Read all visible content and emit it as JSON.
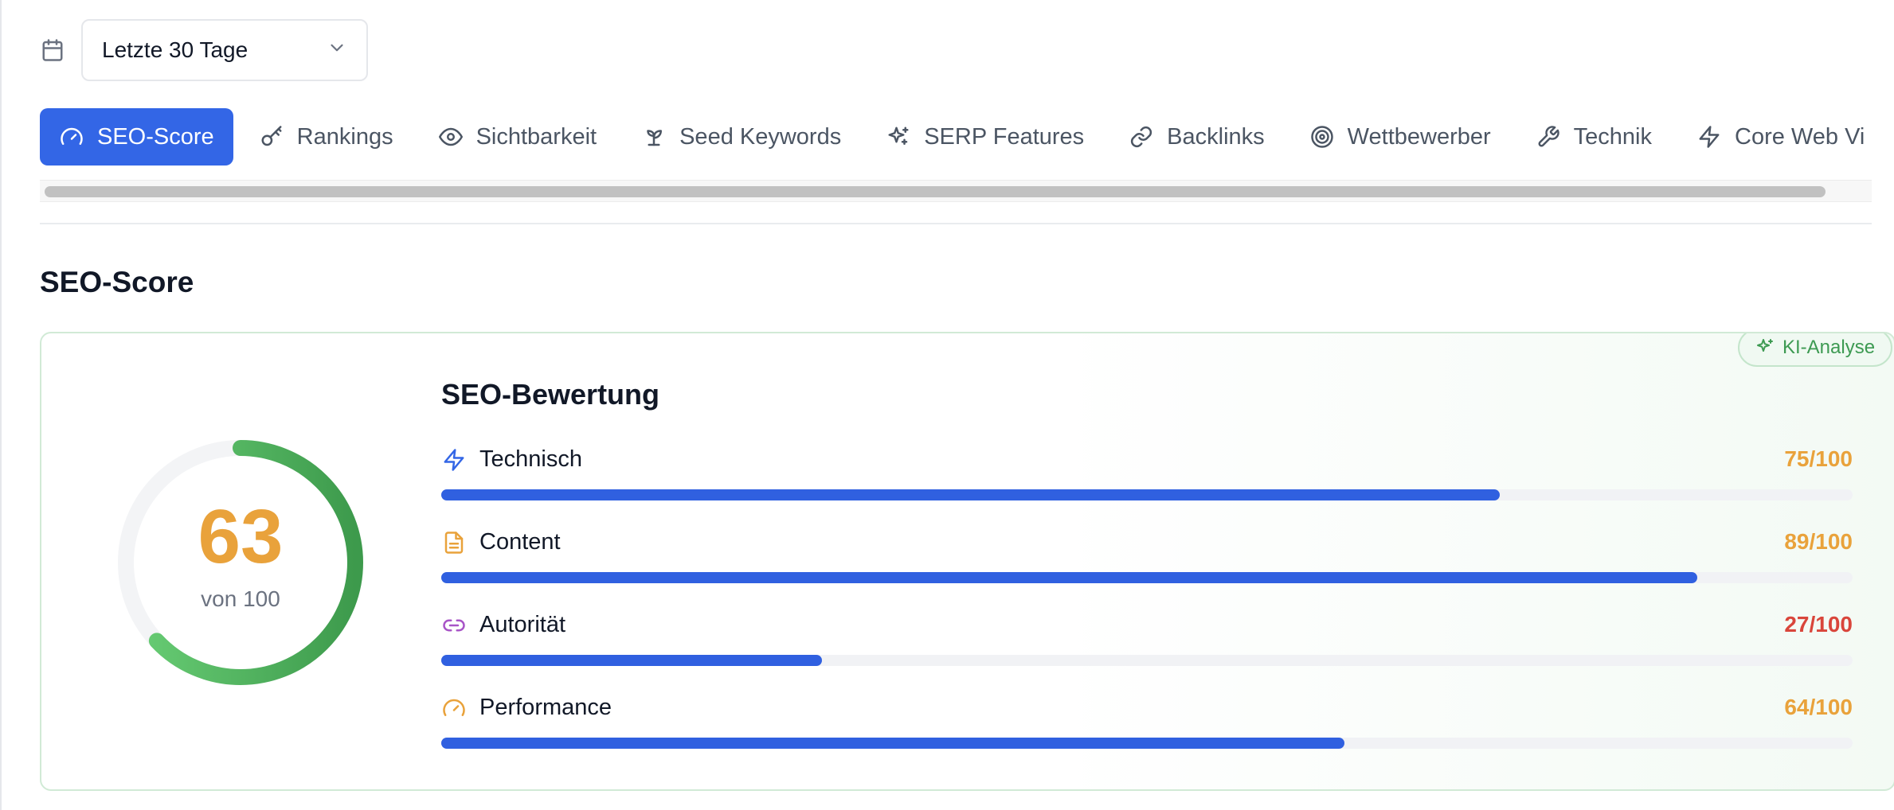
{
  "date_filter": {
    "selected": "Letzte 30 Tage"
  },
  "tabs": [
    {
      "label": "SEO-Score",
      "icon": "gauge-icon",
      "active": true
    },
    {
      "label": "Rankings",
      "icon": "key-icon"
    },
    {
      "label": "Sichtbarkeit",
      "icon": "eye-icon"
    },
    {
      "label": "Seed Keywords",
      "icon": "sprout-icon"
    },
    {
      "label": "SERP Features",
      "icon": "sparkles-icon"
    },
    {
      "label": "Backlinks",
      "icon": "link-icon"
    },
    {
      "label": "Wettbewerber",
      "icon": "target-icon"
    },
    {
      "label": "Technik",
      "icon": "wrench-icon"
    },
    {
      "label": "Core Web Vi",
      "icon": "zap-icon"
    }
  ],
  "section": {
    "title": "SEO-Score"
  },
  "card": {
    "badge": "KI-Analyse",
    "score": {
      "value": "63",
      "max_label": "von 100",
      "fraction": 0.63,
      "color": "#4caf50"
    },
    "title": "SEO-Bewertung",
    "metrics": [
      {
        "label": "Technisch",
        "value": "75/100",
        "score": 75,
        "icon": "zap-icon",
        "icon_color": "#3366e6",
        "value_color": "#e9a23b"
      },
      {
        "label": "Content",
        "value": "89/100",
        "score": 89,
        "icon": "file-text-icon",
        "icon_color": "#e9a23b",
        "value_color": "#e9a23b"
      },
      {
        "label": "Autorität",
        "value": "27/100",
        "score": 27,
        "icon": "link-icon",
        "icon_color": "#a855c7",
        "value_color": "#d9453b"
      },
      {
        "label": "Performance",
        "value": "64/100",
        "score": 64,
        "icon": "gauge-icon",
        "icon_color": "#e9a23b",
        "value_color": "#e9a23b"
      }
    ]
  }
}
